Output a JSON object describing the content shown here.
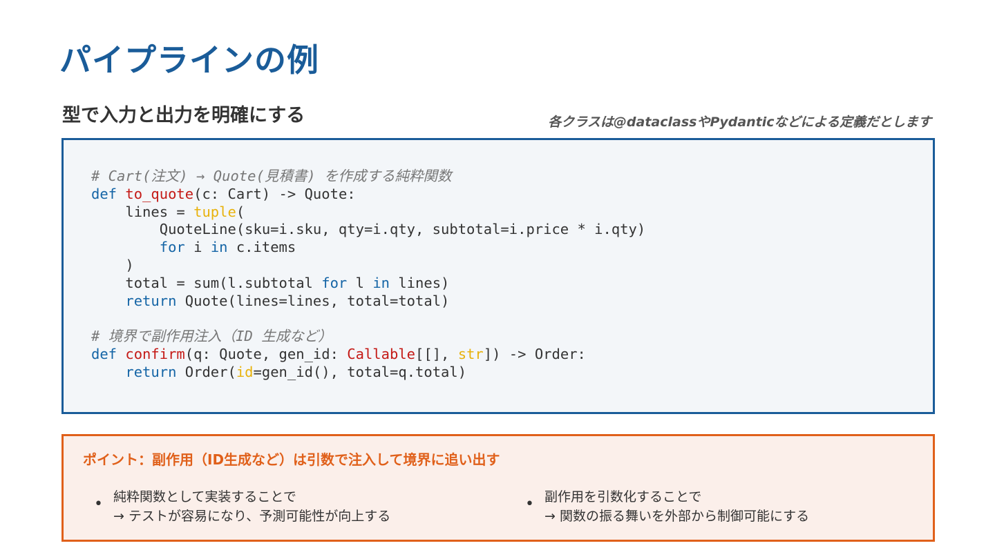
{
  "slide": {
    "title": "パイプラインの例",
    "subtitle": "型で入力と出力を明確にする",
    "note": "各クラスは@dataclassやPydanticなどによる定義だとします"
  },
  "code": {
    "lines": [
      [
        {
          "t": "comment",
          "v": "# Cart(注文) → Quote(見積書) を作成する純粋関数"
        }
      ],
      [
        {
          "t": "kw",
          "v": "def "
        },
        {
          "t": "fn",
          "v": "to_quote"
        },
        {
          "t": "plain",
          "v": "(c: Cart) -> Quote:"
        }
      ],
      [
        {
          "t": "plain",
          "v": "    lines = "
        },
        {
          "t": "builtin",
          "v": "tuple"
        },
        {
          "t": "plain",
          "v": "("
        }
      ],
      [
        {
          "t": "plain",
          "v": "        QuoteLine(sku=i.sku, qty=i.qty, subtotal=i.price * i.qty)"
        }
      ],
      [
        {
          "t": "plain",
          "v": "        "
        },
        {
          "t": "kw",
          "v": "for"
        },
        {
          "t": "plain",
          "v": " i "
        },
        {
          "t": "kw",
          "v": "in"
        },
        {
          "t": "plain",
          "v": " c.items"
        }
      ],
      [
        {
          "t": "plain",
          "v": "    )"
        }
      ],
      [
        {
          "t": "plain",
          "v": "    total = sum(l.subtotal "
        },
        {
          "t": "kw",
          "v": "for"
        },
        {
          "t": "plain",
          "v": " l "
        },
        {
          "t": "kw",
          "v": "in"
        },
        {
          "t": "plain",
          "v": " lines)"
        }
      ],
      [
        {
          "t": "plain",
          "v": "    "
        },
        {
          "t": "kw",
          "v": "return"
        },
        {
          "t": "plain",
          "v": " Quote(lines=lines, total=total)"
        }
      ],
      [
        {
          "t": "plain",
          "v": ""
        }
      ],
      [
        {
          "t": "comment",
          "v": "# 境界で副作用注入（ID 生成など）"
        }
      ],
      [
        {
          "t": "kw",
          "v": "def "
        },
        {
          "t": "fn",
          "v": "confirm"
        },
        {
          "t": "plain",
          "v": "(q: Quote, gen_id: "
        },
        {
          "t": "fn",
          "v": "Callable"
        },
        {
          "t": "plain",
          "v": "[[], "
        },
        {
          "t": "builtin",
          "v": "str"
        },
        {
          "t": "plain",
          "v": "]) -> Order:"
        }
      ],
      [
        {
          "t": "plain",
          "v": "    "
        },
        {
          "t": "kw",
          "v": "return"
        },
        {
          "t": "plain",
          "v": " Order("
        },
        {
          "t": "builtin",
          "v": "id"
        },
        {
          "t": "plain",
          "v": "=gen_id(), total=q.total)"
        }
      ]
    ]
  },
  "point": {
    "title": "ポイント：副作用（ID生成など）は引数で注入して境界に追い出す",
    "items": [
      {
        "line1": "純粋関数として実装することで",
        "line2": "→ テストが容易になり、予測可能性が向上する"
      },
      {
        "line1": "副作用を引数化することで",
        "line2": "→ 関数の振る舞いを外部から制御可能にする"
      }
    ],
    "bullet": "•"
  },
  "colors": {
    "title": "#1a5c99",
    "code_border": "#1a5c99",
    "code_bg": "#f3f6f9",
    "keyword": "#1565a6",
    "function": "#c41a16",
    "builtin": "#e8b20c",
    "comment": "#777777",
    "point_border": "#e0601a",
    "point_bg": "#fbefea"
  }
}
